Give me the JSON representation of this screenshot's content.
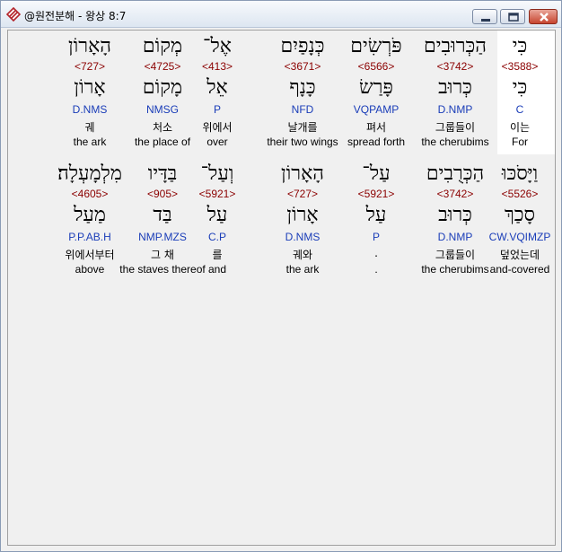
{
  "window": {
    "title": "@원전분해 - 왕상 8:7"
  },
  "colors": {
    "strong": "#8b0000",
    "parse": "#1a3db8",
    "highlight": "#ffffff"
  },
  "icons": {
    "app": "bible-app-icon",
    "minimize": "minimize-icon",
    "maximize": "maximize-icon",
    "close": "close-icon"
  },
  "rows": [
    {
      "words": [
        {
          "heb": "כִּי",
          "strong": "<3588>",
          "lemma": "כִּי",
          "parse": "C",
          "kor": "이는",
          "eng": "For"
        },
        {
          "heb": "הַכְּרוּבִים",
          "strong": "<3742>",
          "lemma": "כְּרוּב",
          "parse": "D.NMP",
          "kor": "그룹들이",
          "eng": "the cherubims"
        },
        {
          "heb": "פֹּרְשִׂים",
          "strong": "<6566>",
          "lemma": "פָּרַשׂ",
          "parse": "VQPAMP",
          "kor": "펴서",
          "eng": "spread forth"
        },
        {
          "heb": "כְּנָפַיִם",
          "strong": "<3671>",
          "lemma": "כָּנָף",
          "parse": "NFD",
          "kor": "날개를",
          "eng": "their two wings"
        },
        {
          "heb": "אֶל־",
          "strong": "<413>",
          "lemma": "אֵל",
          "parse": "P",
          "kor": "위에서",
          "eng": "over"
        },
        {
          "heb": "מְקוֹם",
          "strong": "<4725>",
          "lemma": "מָקוֹם",
          "parse": "NMSG",
          "kor": "처소",
          "eng": "the place of"
        },
        {
          "heb": "הָאָרוֹן",
          "strong": "<727>",
          "lemma": "אָרוֹן",
          "parse": "D.NMS",
          "kor": "궤",
          "eng": "the ark"
        }
      ]
    },
    {
      "words": [
        {
          "heb": "וַיָּסֹכּוּ",
          "strong": "<5526>",
          "lemma": "סָכַךְ",
          "parse": "CW.VQIMZP",
          "kor": "덮었는데",
          "eng": "and-covered"
        },
        {
          "heb": "הַכְּרֻבִים",
          "strong": "<3742>",
          "lemma": "כְּרוּב",
          "parse": "D.NMP",
          "kor": "그룹들이",
          "eng": "the cherubims"
        },
        {
          "heb": "עַל־",
          "strong": "<5921>",
          "lemma": "עַל",
          "parse": "P",
          "kor": ".",
          "eng": "."
        },
        {
          "heb": "הָאָרוֹן",
          "strong": "<727>",
          "lemma": "אָרוֹן",
          "parse": "D.NMS",
          "kor": "궤와",
          "eng": "the ark"
        },
        {
          "heb": "וְעַל־",
          "strong": "<5921>",
          "lemma": "עַל",
          "parse": "C.P",
          "kor": "를",
          "eng": "and"
        },
        {
          "heb": "בַּדָּיו",
          "strong": "<905>",
          "lemma": "בַּד",
          "parse": "NMP.MZS",
          "kor": "그 채",
          "eng": "the staves thereof"
        },
        {
          "heb": "מִלְמָעְלָה׃",
          "strong": "<4605>",
          "lemma": "מַעַל",
          "parse": "P.P.AB.H",
          "kor": "위에서부터",
          "eng": "above"
        }
      ]
    }
  ]
}
